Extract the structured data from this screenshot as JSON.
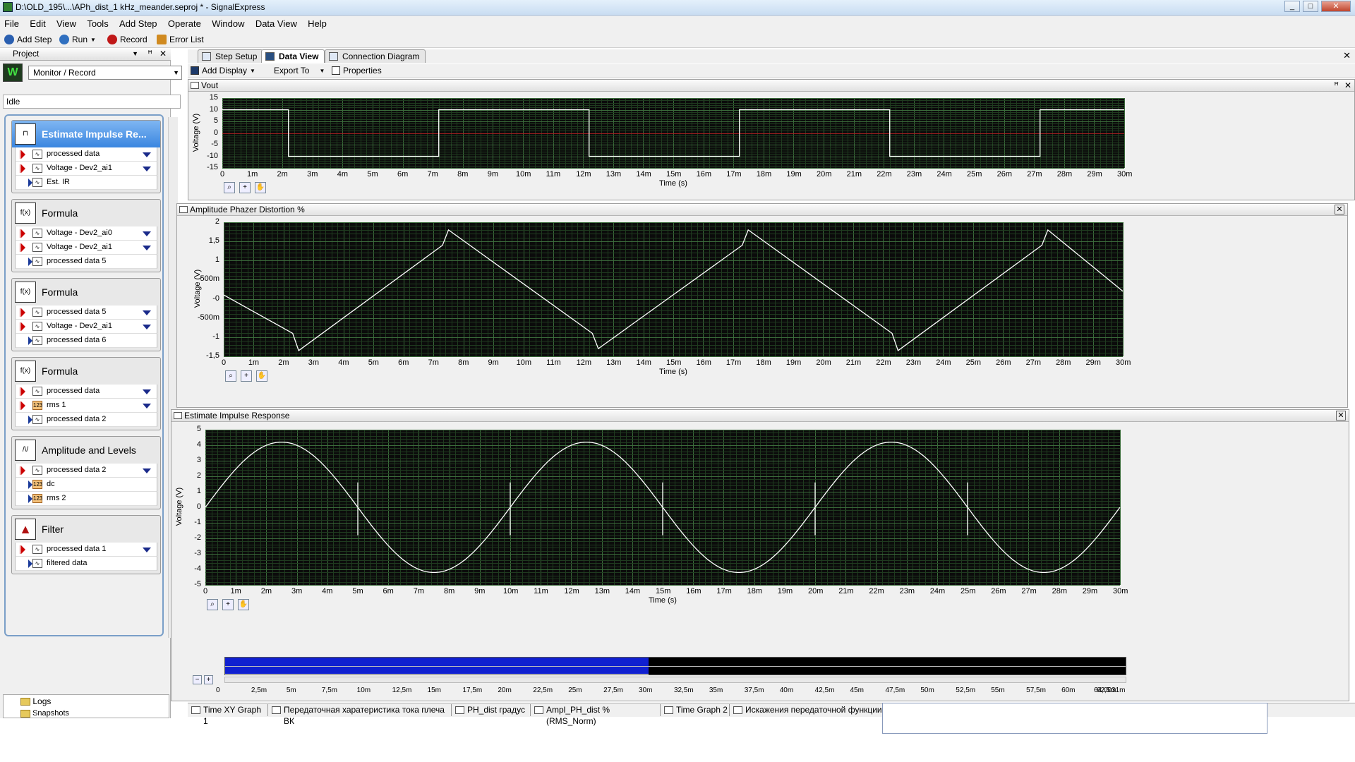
{
  "window": {
    "title": "D:\\OLD_195\\...\\APh_dist_1 kHz_meander.seproj * - SignalExpress",
    "controls": [
      "_",
      "□",
      "✕"
    ]
  },
  "menu": [
    "File",
    "Edit",
    "View",
    "Tools",
    "Add Step",
    "Operate",
    "Window",
    "Data View",
    "Help"
  ],
  "toolbar": {
    "add_step": "Add Step",
    "run": "Run",
    "record": "Record",
    "error_list": "Error List"
  },
  "project": {
    "title": "Project",
    "mode": "Monitor / Record",
    "status": "Idle",
    "steps": [
      {
        "name": "Estimate Impulse Re...",
        "icon": "impulse-icon",
        "selected": true,
        "signals": [
          {
            "dir": "in",
            "type": "wave",
            "label": "processed data",
            "dropdown": true
          },
          {
            "dir": "in",
            "type": "wave",
            "label": "Voltage - Dev2_ai1",
            "dropdown": true
          },
          {
            "dir": "out",
            "type": "wave",
            "label": "Est. IR",
            "dropdown": false
          }
        ]
      },
      {
        "name": "Formula",
        "icon": "formula-icon",
        "selected": false,
        "signals": [
          {
            "dir": "in",
            "type": "wave",
            "label": "Voltage - Dev2_ai0",
            "dropdown": true
          },
          {
            "dir": "in",
            "type": "wave",
            "label": "Voltage - Dev2_ai1",
            "dropdown": true
          },
          {
            "dir": "out",
            "type": "wave",
            "label": "processed data 5",
            "dropdown": false
          }
        ]
      },
      {
        "name": "Formula",
        "icon": "formula-icon",
        "selected": false,
        "signals": [
          {
            "dir": "in",
            "type": "wave",
            "label": "processed data 5",
            "dropdown": true
          },
          {
            "dir": "in",
            "type": "wave",
            "label": "Voltage - Dev2_ai1",
            "dropdown": true
          },
          {
            "dir": "out",
            "type": "wave",
            "label": "processed data 6",
            "dropdown": false
          }
        ]
      },
      {
        "name": "Formula",
        "icon": "formula-icon",
        "selected": false,
        "signals": [
          {
            "dir": "in",
            "type": "wave",
            "label": "processed data",
            "dropdown": true
          },
          {
            "dir": "in",
            "type": "num",
            "label": "rms 1",
            "dropdown": true
          },
          {
            "dir": "out",
            "type": "wave",
            "label": "processed data 2",
            "dropdown": false
          }
        ]
      },
      {
        "name": "Amplitude and Levels",
        "icon": "levels-icon",
        "selected": false,
        "signals": [
          {
            "dir": "in",
            "type": "wave",
            "label": "processed data 2",
            "dropdown": true
          },
          {
            "dir": "out",
            "type": "num",
            "label": "dc",
            "dropdown": false
          },
          {
            "dir": "out",
            "type": "num",
            "label": "rms 2",
            "dropdown": false
          }
        ]
      },
      {
        "name": "Filter",
        "icon": "filter-icon",
        "selected": false,
        "signals": [
          {
            "dir": "in",
            "type": "wave",
            "label": "processed data 1",
            "dropdown": true
          },
          {
            "dir": "out",
            "type": "wave",
            "label": "filtered data",
            "dropdown": false
          }
        ]
      }
    ],
    "bottom": {
      "logs": "Logs",
      "snapshots": "Snapshots"
    }
  },
  "tabs": [
    "Step Setup",
    "Data View",
    "Connection Diagram"
  ],
  "active_tab": "Data View",
  "dataview_toolbar": {
    "add_display": "Add Display",
    "export_to": "Export To",
    "properties": "Properties"
  },
  "graphs": {
    "vout": {
      "title": "Vout",
      "xlabel": "Time (s)",
      "ylabel": "Voltage (V)",
      "yticks": [
        "15",
        "10",
        "5",
        "0",
        "-5",
        "-10",
        "-15"
      ],
      "xticks": [
        "0",
        "1m",
        "2m",
        "3m",
        "4m",
        "5m",
        "6m",
        "7m",
        "8m",
        "9m",
        "10m",
        "11m",
        "12m",
        "13m",
        "14m",
        "15m",
        "16m",
        "17m",
        "18m",
        "19m",
        "20m",
        "21m",
        "22m",
        "23m",
        "24m",
        "25m",
        "26m",
        "27m",
        "28m",
        "29m",
        "30m"
      ]
    },
    "aphd": {
      "title": "Amplitude Phazer Distortion %",
      "xlabel": "Time (s)",
      "ylabel": "Voltage (V)",
      "yticks": [
        "2",
        "1,5",
        "1",
        "500m",
        "-0",
        "-500m",
        "-1",
        "-1,5"
      ],
      "xticks": [
        "0",
        "1m",
        "2m",
        "3m",
        "4m",
        "5m",
        "6m",
        "7m",
        "8m",
        "9m",
        "10m",
        "11m",
        "12m",
        "13m",
        "14m",
        "15m",
        "16m",
        "17m",
        "18m",
        "19m",
        "20m",
        "21m",
        "22m",
        "23m",
        "24m",
        "25m",
        "26m",
        "27m",
        "28m",
        "29m",
        "30m"
      ]
    },
    "eir": {
      "title": "Estimate Impulse Response",
      "xlabel": "Time (s)",
      "ylabel": "Voltage (V)",
      "yticks": [
        "5",
        "4",
        "3",
        "2",
        "1",
        "0",
        "-1",
        "-2",
        "-3",
        "-4",
        "-5"
      ],
      "xticks": [
        "0",
        "1m",
        "2m",
        "3m",
        "4m",
        "5m",
        "6m",
        "7m",
        "8m",
        "9m",
        "10m",
        "11m",
        "12m",
        "13m",
        "14m",
        "15m",
        "16m",
        "17m",
        "18m",
        "19m",
        "20m",
        "21m",
        "22m",
        "23m",
        "24m",
        "25m",
        "26m",
        "27m",
        "28m",
        "29m",
        "30m"
      ],
      "overview_ticks": [
        "0",
        "2,5m",
        "5m",
        "7,5m",
        "10m",
        "12,5m",
        "15m",
        "17,5m",
        "20m",
        "22,5m",
        "25m",
        "27,5m",
        "30m",
        "32,5m",
        "35m",
        "37,5m",
        "40m",
        "42,5m",
        "45m",
        "47,5m",
        "50m",
        "52,5m",
        "55m",
        "57,5m",
        "60m",
        "62,5m",
        "64,0031m"
      ]
    }
  },
  "chart_data": [
    {
      "type": "line",
      "title": "Vout",
      "xlabel": "Time (s)",
      "ylabel": "Voltage (V)",
      "xlim": [
        0,
        0.03
      ],
      "ylim": [
        -15,
        15
      ],
      "series": [
        {
          "x": [
            0,
            0.0022,
            0.0022,
            0.0072,
            0.0072,
            0.0122,
            0.0122,
            0.0172,
            0.0172,
            0.0222,
            0.0222,
            0.0272,
            0.0272,
            0.03
          ],
          "y": [
            10,
            10,
            -10,
            -10,
            10,
            10,
            -10,
            -10,
            10,
            10,
            -10,
            -10,
            10,
            10
          ]
        }
      ]
    },
    {
      "type": "line",
      "title": "Amplitude Phazer Distortion %",
      "xlabel": "Time (s)",
      "ylabel": "Voltage (V)",
      "xlim": [
        0,
        0.03
      ],
      "ylim": [
        -1.5,
        2
      ],
      "series": [
        {
          "x": [
            0,
            0.0023,
            0.0025,
            0.0073,
            0.0075,
            0.0123,
            0.0125,
            0.0173,
            0.0175,
            0.0223,
            0.0225,
            0.0273,
            0.0275,
            0.03
          ],
          "y": [
            0.1,
            -0.9,
            -1.35,
            1.4,
            1.8,
            -0.9,
            -1.3,
            1.4,
            1.8,
            -0.9,
            -1.35,
            1.4,
            1.8,
            0.2
          ]
        }
      ]
    },
    {
      "type": "line",
      "title": "Estimate Impulse Response",
      "xlabel": "Time (s)",
      "ylabel": "Voltage (V)",
      "xlim": [
        0,
        0.03
      ],
      "ylim": [
        -5,
        5
      ],
      "series": [
        {
          "x": [
            0,
            0.0025,
            0.005,
            0.0075,
            0.01,
            0.0125,
            0.015,
            0.0175,
            0.02,
            0.0225,
            0.025,
            0.0275,
            0.03
          ],
          "y": [
            0,
            4.2,
            0,
            -4.2,
            0,
            4.2,
            0,
            -4.2,
            0,
            4.2,
            0,
            -4.2,
            0
          ]
        }
      ]
    }
  ],
  "bottom_tabs": [
    "Time XY Graph 1",
    "Передаточная харатеристика тока плеча ВК",
    "PH_dist градус",
    "Ampl_PH_dist % (RMS_Norm)",
    "Time Graph 2",
    "Искажения передаточной функции"
  ]
}
